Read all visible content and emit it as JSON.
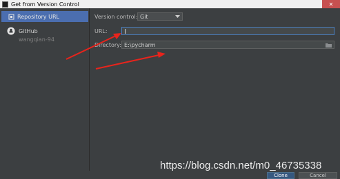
{
  "window": {
    "title": "Get from Version Control",
    "close_glyph": "✕"
  },
  "sidebar": {
    "items": [
      {
        "label": "Repository URL",
        "icon": "repository-icon"
      },
      {
        "label": "GitHub",
        "sublabel": "wangqian-94",
        "icon": "github-icon"
      }
    ]
  },
  "form": {
    "version_control_label": "Version control:",
    "version_control_value": "Git",
    "url_label": "URL:",
    "url_value": "",
    "directory_label": "Directory:",
    "directory_value": "E:\\pycharm"
  },
  "buttons": {
    "clone": "Clone",
    "cancel": "Cancel"
  },
  "watermark": "https://blog.csdn.net/m0_46735338",
  "colors": {
    "background": "#3c3f41",
    "selection": "#4b6eaf",
    "annotation_arrow": "#e8241c"
  }
}
